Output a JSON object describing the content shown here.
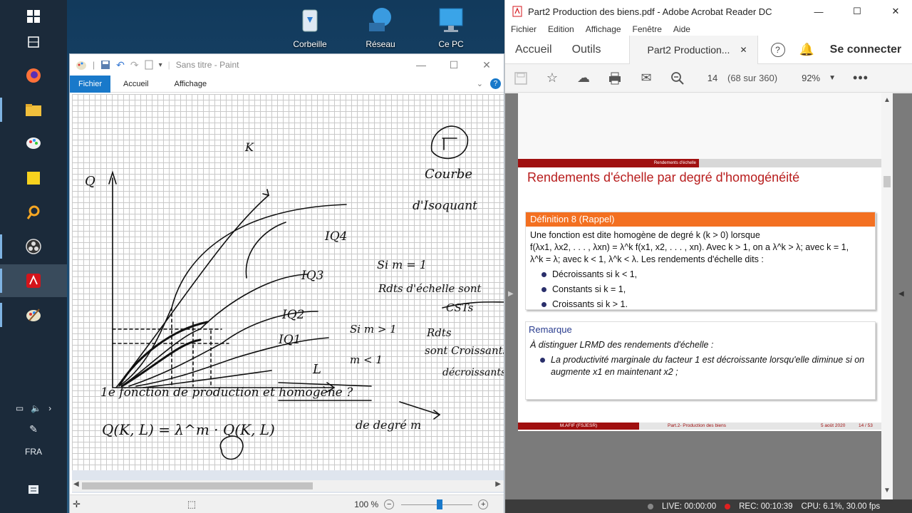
{
  "taskbar": {
    "tray_language": "FRA"
  },
  "desktop_icons": [
    {
      "label": "Corbeille"
    },
    {
      "label": "Réseau"
    },
    {
      "label": "Ce PC"
    }
  ],
  "paint": {
    "title": "Sans titre - Paint",
    "tabs": {
      "file": "Fichier",
      "home": "Accueil",
      "view": "Affichage"
    },
    "zoom": "100 %"
  },
  "acrobat": {
    "title": "Part2 Production des biens.pdf - Adobe Acrobat Reader DC",
    "menu": [
      "Fichier",
      "Edition",
      "Affichage",
      "Fenêtre",
      "Aide"
    ],
    "tabs": {
      "home": "Accueil",
      "tools": "Outils",
      "doc": "Part2 Production..."
    },
    "sign_in": "Se connecter",
    "page_number": "14",
    "page_total": "(68 sur 360)",
    "zoom": "92%",
    "slide": {
      "section": "Rendements d'échelle",
      "title": "Rendements d'échelle par degré d'homogénéité",
      "def_header": "Définition 8 (Rappel)",
      "def_line1": "Une fonction est dite homogène de degré k (k > 0) lorsque",
      "def_line2": "f(λx1, λx2, . . . , λxn) = λ^k f(x1, x2, . . . , xn). Avec k > 1, on a λ^k > λ; avec k = 1,",
      "def_line3": "λ^k = λ; avec k < 1, λ^k < λ. Les rendements d'échelle dits :",
      "bullets": [
        "Décroissants si k < 1,",
        "Constants si k = 1,",
        "Croissants si k > 1."
      ],
      "rem_header": "Remarque",
      "rem_line1": "À distinguer LRMD des rendements d'échelle :",
      "rem_bullet": "La productivité marginale du facteur 1 est décroissante lorsqu'elle diminue si on augmente x1 en maintenant x2 ;",
      "footer_left": "M.AFIF (FSJESR)",
      "footer_mid": "Part.2- Production des biens",
      "footer_date": "5 août 2020",
      "footer_page": "14 / 53"
    },
    "status": {
      "live": "LIVE: 00:00:00",
      "rec": "REC: 00:10:39",
      "cpu": "CPU: 6.1%, 30.00 fps"
    }
  },
  "sketch_text": {
    "k": "K",
    "q": "Q",
    "courbe": "Courbe",
    "isoquant": "d'Isoquant",
    "iq4": "IQ4",
    "iq3": "IQ3",
    "iq2": "IQ2",
    "iq1": "IQ1",
    "sim": "Si m = 1",
    "rdts_const": "Rdts d'échelle sont",
    "csts": "CSTs",
    "sim_gt": "Si m > 1",
    "rdts": "Rdts",
    "sont_crois": "sont Croissants",
    "sim_lt": "m < 1",
    "decr": "décroissants",
    "l": "L",
    "question": "1e fonction de production et homogène ?",
    "equation": "Q(K, L) = λ^m · Q(K, L)",
    "degree": "de degré m"
  }
}
